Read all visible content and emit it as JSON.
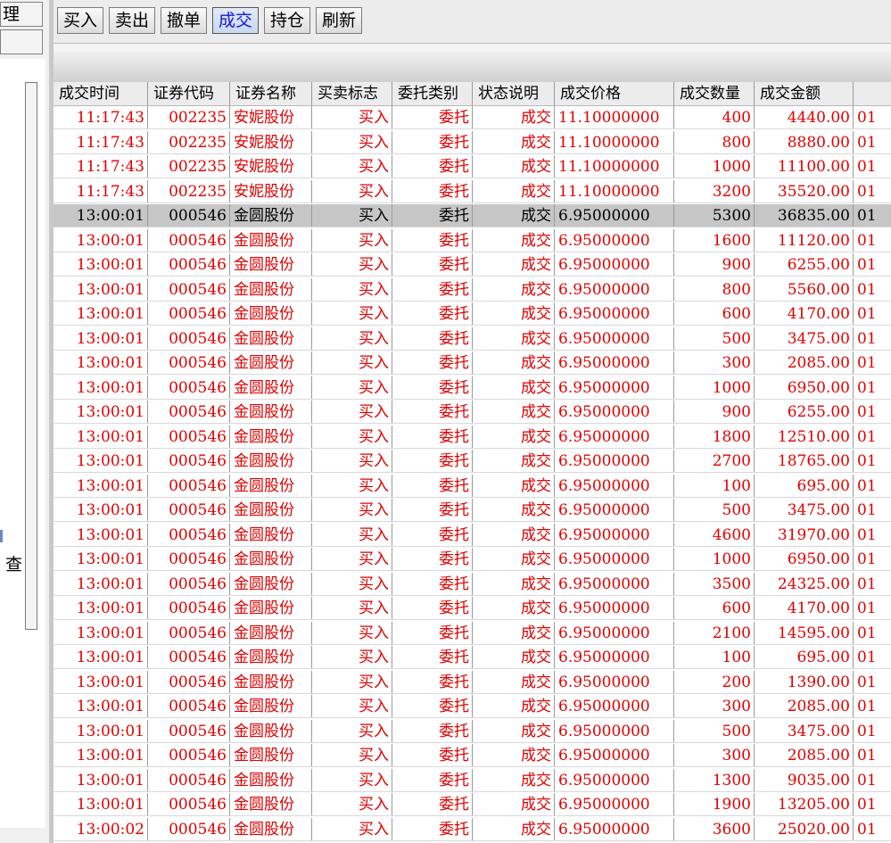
{
  "left_panel": {
    "tab1": "理",
    "tab2": "",
    "side_label": "查"
  },
  "toolbar": {
    "buttons": [
      {
        "label": "买入",
        "active": false
      },
      {
        "label": "卖出",
        "active": false
      },
      {
        "label": "撤单",
        "active": false
      },
      {
        "label": "成交",
        "active": true
      },
      {
        "label": "持仓",
        "active": false
      },
      {
        "label": "刷新",
        "active": false
      }
    ]
  },
  "table": {
    "columns": [
      "成交时间",
      "证券代码",
      "证券名称",
      "买卖标志",
      "委托类别",
      "状态说明",
      "成交价格",
      "成交数量",
      "成交金额",
      ""
    ],
    "selected_row": 4,
    "rows": [
      [
        "11:17:43",
        "002235",
        "安妮股份",
        "买入",
        "委托",
        "成交",
        "11.10000000",
        "400",
        "4440.00",
        "01"
      ],
      [
        "11:17:43",
        "002235",
        "安妮股份",
        "买入",
        "委托",
        "成交",
        "11.10000000",
        "800",
        "8880.00",
        "01"
      ],
      [
        "11:17:43",
        "002235",
        "安妮股份",
        "买入",
        "委托",
        "成交",
        "11.10000000",
        "1000",
        "11100.00",
        "01"
      ],
      [
        "11:17:43",
        "002235",
        "安妮股份",
        "买入",
        "委托",
        "成交",
        "11.10000000",
        "3200",
        "35520.00",
        "01"
      ],
      [
        "13:00:01",
        "000546",
        "金圆股份",
        "买入",
        "委托",
        "成交",
        "6.95000000",
        "5300",
        "36835.00",
        "01"
      ],
      [
        "13:00:01",
        "000546",
        "金圆股份",
        "买入",
        "委托",
        "成交",
        "6.95000000",
        "1600",
        "11120.00",
        "01"
      ],
      [
        "13:00:01",
        "000546",
        "金圆股份",
        "买入",
        "委托",
        "成交",
        "6.95000000",
        "900",
        "6255.00",
        "01"
      ],
      [
        "13:00:01",
        "000546",
        "金圆股份",
        "买入",
        "委托",
        "成交",
        "6.95000000",
        "800",
        "5560.00",
        "01"
      ],
      [
        "13:00:01",
        "000546",
        "金圆股份",
        "买入",
        "委托",
        "成交",
        "6.95000000",
        "600",
        "4170.00",
        "01"
      ],
      [
        "13:00:01",
        "000546",
        "金圆股份",
        "买入",
        "委托",
        "成交",
        "6.95000000",
        "500",
        "3475.00",
        "01"
      ],
      [
        "13:00:01",
        "000546",
        "金圆股份",
        "买入",
        "委托",
        "成交",
        "6.95000000",
        "300",
        "2085.00",
        "01"
      ],
      [
        "13:00:01",
        "000546",
        "金圆股份",
        "买入",
        "委托",
        "成交",
        "6.95000000",
        "1000",
        "6950.00",
        "01"
      ],
      [
        "13:00:01",
        "000546",
        "金圆股份",
        "买入",
        "委托",
        "成交",
        "6.95000000",
        "900",
        "6255.00",
        "01"
      ],
      [
        "13:00:01",
        "000546",
        "金圆股份",
        "买入",
        "委托",
        "成交",
        "6.95000000",
        "1800",
        "12510.00",
        "01"
      ],
      [
        "13:00:01",
        "000546",
        "金圆股份",
        "买入",
        "委托",
        "成交",
        "6.95000000",
        "2700",
        "18765.00",
        "01"
      ],
      [
        "13:00:01",
        "000546",
        "金圆股份",
        "买入",
        "委托",
        "成交",
        "6.95000000",
        "100",
        "695.00",
        "01"
      ],
      [
        "13:00:01",
        "000546",
        "金圆股份",
        "买入",
        "委托",
        "成交",
        "6.95000000",
        "500",
        "3475.00",
        "01"
      ],
      [
        "13:00:01",
        "000546",
        "金圆股份",
        "买入",
        "委托",
        "成交",
        "6.95000000",
        "4600",
        "31970.00",
        "01"
      ],
      [
        "13:00:01",
        "000546",
        "金圆股份",
        "买入",
        "委托",
        "成交",
        "6.95000000",
        "1000",
        "6950.00",
        "01"
      ],
      [
        "13:00:01",
        "000546",
        "金圆股份",
        "买入",
        "委托",
        "成交",
        "6.95000000",
        "3500",
        "24325.00",
        "01"
      ],
      [
        "13:00:01",
        "000546",
        "金圆股份",
        "买入",
        "委托",
        "成交",
        "6.95000000",
        "600",
        "4170.00",
        "01"
      ],
      [
        "13:00:01",
        "000546",
        "金圆股份",
        "买入",
        "委托",
        "成交",
        "6.95000000",
        "2100",
        "14595.00",
        "01"
      ],
      [
        "13:00:01",
        "000546",
        "金圆股份",
        "买入",
        "委托",
        "成交",
        "6.95000000",
        "100",
        "695.00",
        "01"
      ],
      [
        "13:00:01",
        "000546",
        "金圆股份",
        "买入",
        "委托",
        "成交",
        "6.95000000",
        "200",
        "1390.00",
        "01"
      ],
      [
        "13:00:01",
        "000546",
        "金圆股份",
        "买入",
        "委托",
        "成交",
        "6.95000000",
        "300",
        "2085.00",
        "01"
      ],
      [
        "13:00:01",
        "000546",
        "金圆股份",
        "买入",
        "委托",
        "成交",
        "6.95000000",
        "500",
        "3475.00",
        "01"
      ],
      [
        "13:00:01",
        "000546",
        "金圆股份",
        "买入",
        "委托",
        "成交",
        "6.95000000",
        "300",
        "2085.00",
        "01"
      ],
      [
        "13:00:01",
        "000546",
        "金圆股份",
        "买入",
        "委托",
        "成交",
        "6.95000000",
        "1300",
        "9035.00",
        "01"
      ],
      [
        "13:00:01",
        "000546",
        "金圆股份",
        "买入",
        "委托",
        "成交",
        "6.95000000",
        "1900",
        "13205.00",
        "01"
      ],
      [
        "13:00:02",
        "000546",
        "金圆股份",
        "买入",
        "委托",
        "成交",
        "6.95000000",
        "3600",
        "25020.00",
        "01"
      ]
    ]
  },
  "colors": {
    "row_text": "#e00000",
    "selected_row_bg": "#c6c6c6",
    "active_tab_text": "#1717e0"
  }
}
